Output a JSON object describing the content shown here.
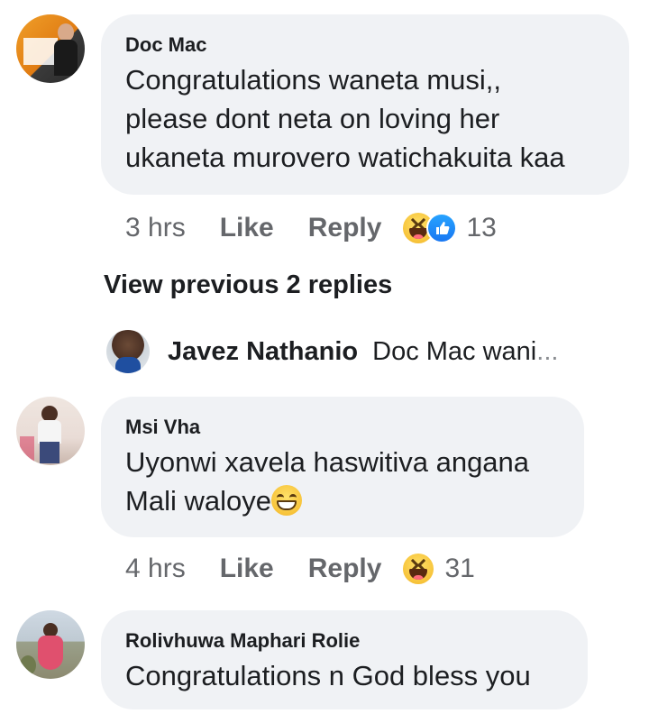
{
  "comments": [
    {
      "author": "Doc Mac",
      "lines": [
        "Congratulations waneta musi,,",
        "please dont neta on loving her",
        "ukaneta murovero watichakuita kaa"
      ],
      "time": "3 hrs",
      "like_label": "Like",
      "reply_label": "Reply",
      "reactions": [
        "haha-icon",
        "like-icon"
      ],
      "reaction_count": "13"
    },
    {
      "author": "Msi Vha",
      "lines": [
        "Uyonwi xavela haswitiva angana",
        "Mali waloye"
      ],
      "time": "4 hrs",
      "like_label": "Like",
      "reply_label": "Reply",
      "reactions": [
        "haha-icon"
      ],
      "reaction_count": "31"
    },
    {
      "author": "Rolivhuwa Maphari Rolie",
      "lines": [
        "Congratulations n God bless you"
      ]
    }
  ],
  "view_previous_label": "View previous 2 replies",
  "reply_preview": {
    "author": "Javez Nathanio",
    "text": "Doc Mac wani",
    "ellipsis": "..."
  },
  "colors": {
    "bubble": "#f0f2f5",
    "meta_text": "#65676b",
    "primary_text": "#1c1e21",
    "like_blue": "#1877f2"
  }
}
